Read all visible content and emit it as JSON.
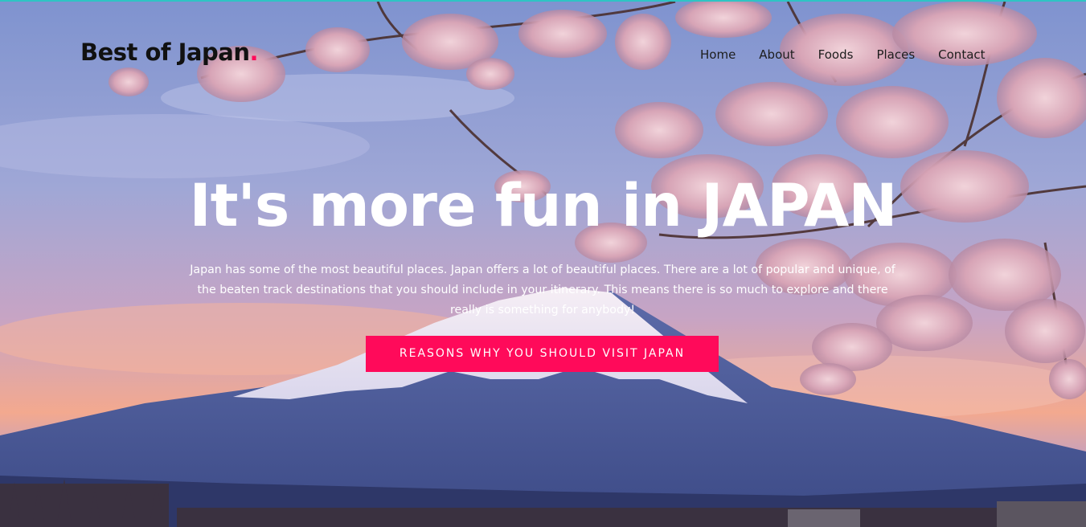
{
  "header": {
    "brand": "Best of Japan",
    "brand_dot": ".",
    "nav": [
      {
        "label": "Home"
      },
      {
        "label": "About"
      },
      {
        "label": "Foods"
      },
      {
        "label": "Places"
      },
      {
        "label": "Contact"
      }
    ]
  },
  "hero": {
    "title": "It's more fun in JAPAN",
    "text": "Japan has some of the most beautiful places. Japan offers a lot of beautiful places. There are a lot of popular and unique, of the beaten track destinations that you should include in your itinerary. This means there is so much to explore and there really is something for anybody!",
    "cta_label": "REASONS WHY YOU SHOULD VISIT JAPAN",
    "background_image": "mount-fuji-with-cherry-blossoms"
  },
  "colors": {
    "accent": "#ff0a5a",
    "title_text": "#ffffff",
    "brand_text": "#111111"
  }
}
